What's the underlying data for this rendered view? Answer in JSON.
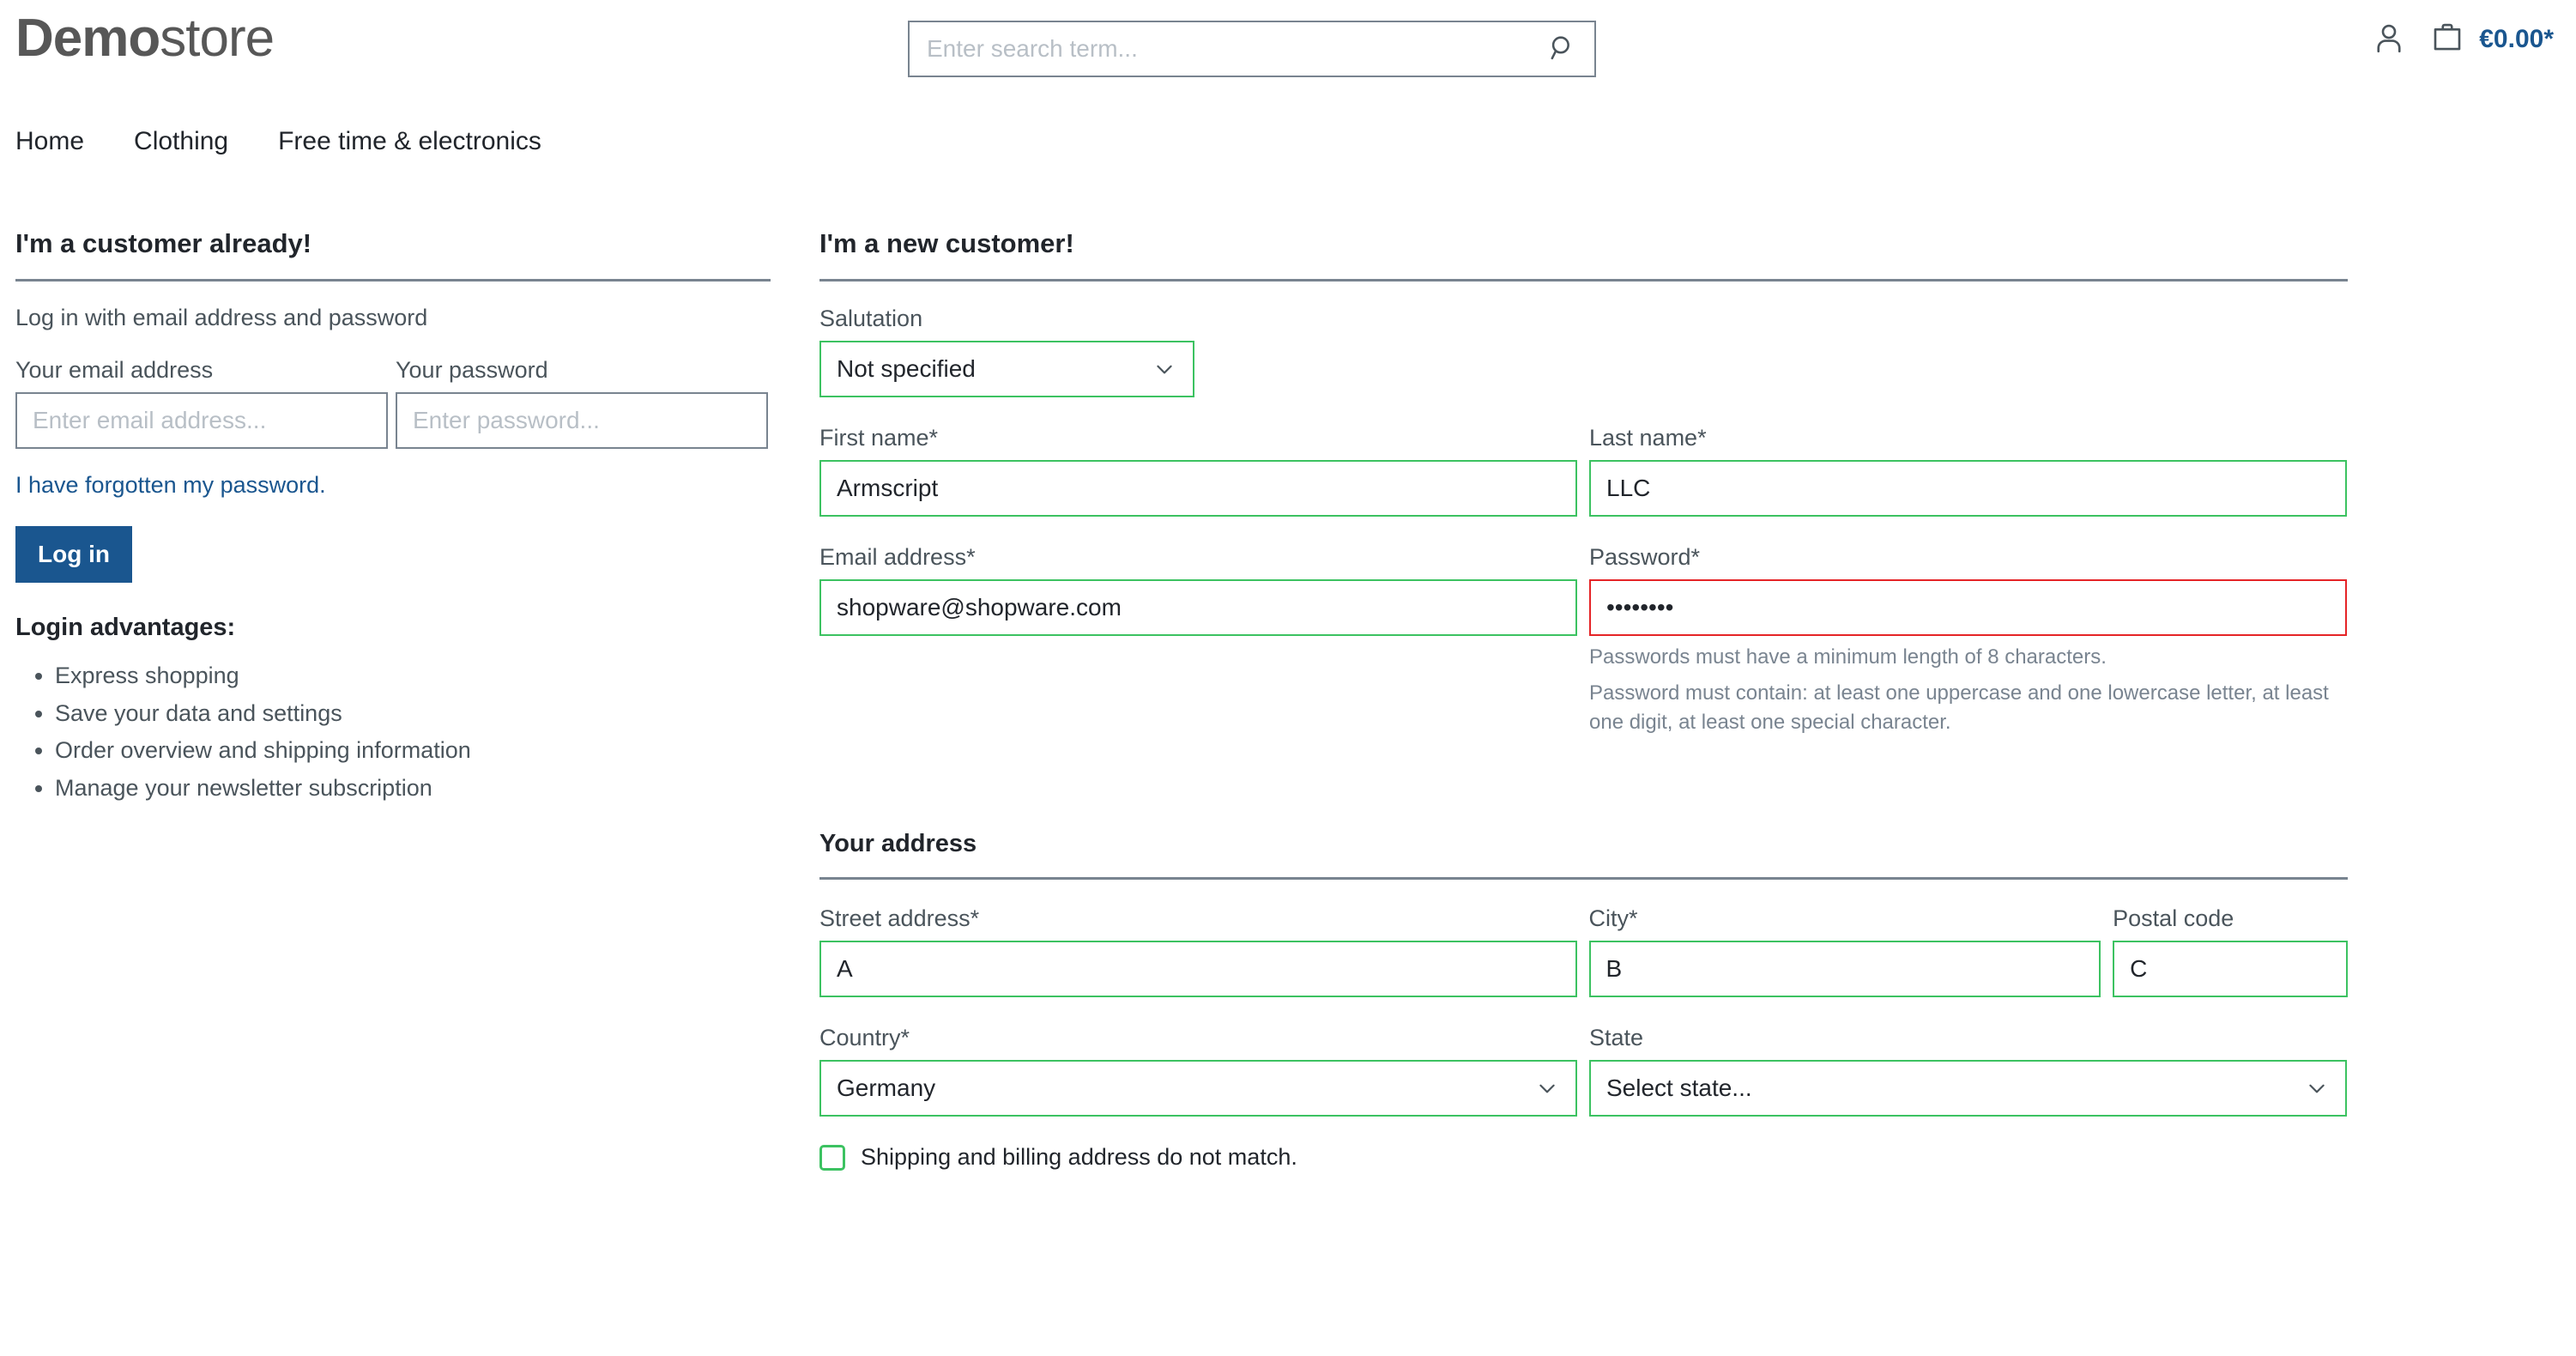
{
  "header": {
    "logo_bold": "Demo",
    "logo_light": "store",
    "search": {
      "placeholder": "Enter search term...",
      "value": "",
      "icon": "search-icon"
    },
    "account_icon": "user-icon",
    "cart_icon": "shopping-bag-icon",
    "cart_amount": "€0.00*"
  },
  "nav": {
    "items": [
      {
        "label": "Home"
      },
      {
        "label": "Clothing"
      },
      {
        "label": "Free time & electronics"
      }
    ]
  },
  "login": {
    "title": "I'm a customer already!",
    "subtitle": "Log in with email address and password",
    "email_label": "Your email address",
    "email_placeholder": "Enter email address...",
    "email_value": "",
    "password_label": "Your password",
    "password_placeholder": "Enter password...",
    "password_value": "",
    "forgot_link": "I have forgotten my password.",
    "submit_label": "Log in",
    "advantages_title": "Login advantages:",
    "advantages": [
      "Express shopping",
      "Save your data and settings",
      "Order overview and shipping information",
      "Manage your newsletter subscription"
    ]
  },
  "register": {
    "title": "I'm a new customer!",
    "salutation_label": "Salutation",
    "salutation_value": "Not specified",
    "first_name_label": "First name*",
    "first_name_value": "Armscript",
    "last_name_label": "Last name*",
    "last_name_value": "LLC",
    "email_label": "Email address*",
    "email_value": "shopware@shopware.com",
    "password_label": "Password*",
    "password_value": "••••••••",
    "password_help_1": "Passwords must have a minimum length of 8 characters.",
    "password_help_2": "Password must contain: at least one uppercase and one lowercase letter, at least one digit, at least one special character.",
    "address": {
      "title": "Your address",
      "street_label": "Street address*",
      "street_value": "A",
      "city_label": "City*",
      "city_value": "B",
      "postal_label": "Postal code",
      "postal_value": "C",
      "country_label": "Country*",
      "country_value": "Germany",
      "state_label": "State",
      "state_value": "Select state...",
      "different_shipping_label": "Shipping and billing address do not match.",
      "different_shipping_checked": false
    }
  },
  "colors": {
    "brand_blue": "#1a568f",
    "valid_green": "#3cc261",
    "invalid_red": "#e52427",
    "border_gray": "#798490",
    "text_dark": "#21252b"
  }
}
